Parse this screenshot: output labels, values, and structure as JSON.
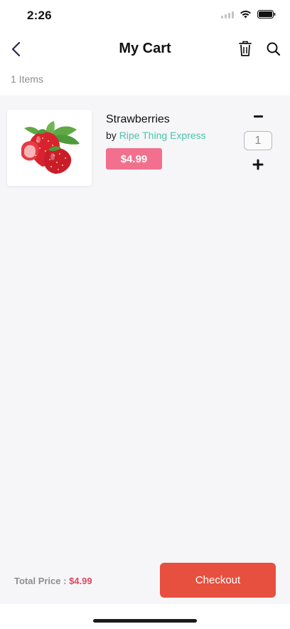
{
  "status_bar": {
    "time": "2:26"
  },
  "header": {
    "title": "My Cart"
  },
  "cart": {
    "items_count": "1 Items",
    "items": [
      {
        "name": "Strawberries",
        "by_label": "by",
        "seller": "Ripe Thing Express",
        "price": "$4.99",
        "quantity": "1",
        "image_icon": "strawberries-image"
      }
    ]
  },
  "footer": {
    "total_label": "Total Price :",
    "total_value": "$4.99",
    "checkout_label": "Checkout"
  },
  "colors": {
    "accent_red": "#e7503f",
    "price_pink": "#f2708d",
    "seller_teal": "#4dc3ac",
    "total_red": "#e04857"
  }
}
